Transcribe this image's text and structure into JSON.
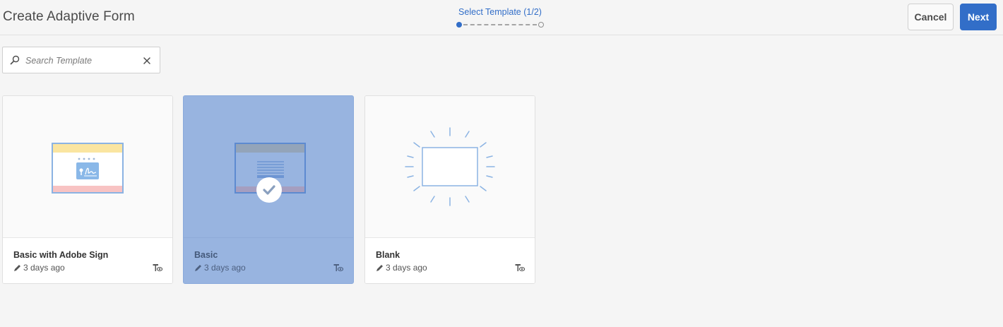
{
  "header": {
    "title": "Create Adaptive Form",
    "wizard_step": "Select Template (1/2)",
    "cancel_label": "Cancel",
    "next_label": "Next"
  },
  "search": {
    "placeholder": "Search Template",
    "value": ""
  },
  "templates": [
    {
      "name": "Basic with Adobe Sign",
      "modified": "3 days ago",
      "selected": false,
      "thumbnail": "form-with-signature-icon"
    },
    {
      "name": "Basic",
      "modified": "3 days ago",
      "selected": true,
      "thumbnail": "basic-form-icon"
    },
    {
      "name": "Blank",
      "modified": "3 days ago",
      "selected": false,
      "thumbnail": "blank-form-icon"
    }
  ],
  "colors": {
    "accent": "#326ec8",
    "selected_card": "#98b4e0",
    "background": "#f5f5f5"
  }
}
